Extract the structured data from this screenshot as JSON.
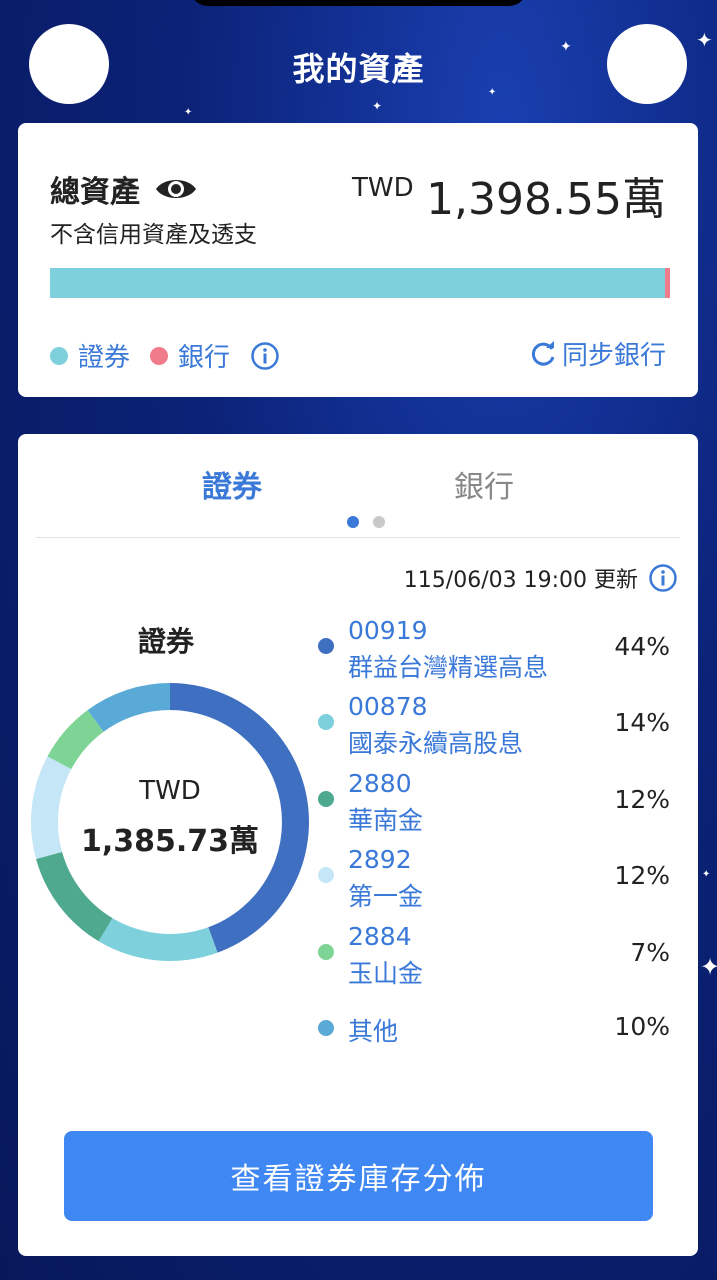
{
  "header": {
    "title": "我的資產"
  },
  "summary": {
    "label": "總資產",
    "subtitle": "不含信用資產及透支",
    "currency": "TWD",
    "value": "1,398.55萬",
    "legend": [
      {
        "label": "證券",
        "color": "#7ed0dd"
      },
      {
        "label": "銀行",
        "color": "#f07b8a"
      }
    ],
    "sync_label": "同步銀行"
  },
  "tabs": [
    {
      "label": "證券",
      "active": true
    },
    {
      "label": "銀行",
      "active": false
    }
  ],
  "update_text": "115/06/03 19:00 更新",
  "securities": {
    "title": "證券",
    "currency": "TWD",
    "total": "1,385.73萬",
    "holdings": [
      {
        "code": "00919",
        "name": "群益台灣精選高息",
        "pct": "44%",
        "color": "#3f6fc1"
      },
      {
        "code": "00878",
        "name": "國泰永續高股息",
        "pct": "14%",
        "color": "#7ed0dd"
      },
      {
        "code": "2880",
        "name": "華南金",
        "pct": "12%",
        "color": "#4fa98f"
      },
      {
        "code": "2892",
        "name": "第一金",
        "pct": "12%",
        "color": "#c4e6f7"
      },
      {
        "code": "2884",
        "name": "玉山金",
        "pct": "7%",
        "color": "#7dd495"
      },
      {
        "code": "",
        "name": "其他",
        "pct": "10%",
        "color": "#5aaad8"
      }
    ]
  },
  "chart_data": {
    "type": "pie",
    "categories": [
      "00919 群益台灣精選高息",
      "00878 國泰永續高股息",
      "2880 華南金",
      "2892 第一金",
      "2884 玉山金",
      "其他"
    ],
    "values": [
      44,
      14,
      12,
      12,
      7,
      10
    ],
    "colors": [
      "#3f6fc1",
      "#7ed0dd",
      "#4fa98f",
      "#c4e6f7",
      "#7dd495",
      "#5aaad8"
    ]
  },
  "cta": {
    "label": "查看證券庫存分佈"
  }
}
